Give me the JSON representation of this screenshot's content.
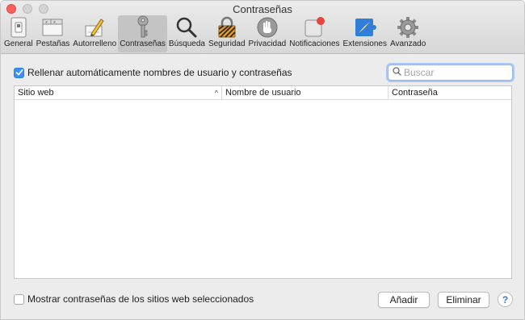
{
  "window": {
    "title": "Contraseñas"
  },
  "toolbar": {
    "items": [
      {
        "label": "General",
        "icon": "general-switch-icon"
      },
      {
        "label": "Pestañas",
        "icon": "tabs-icon"
      },
      {
        "label": "Autorrelleno",
        "icon": "pencil-icon"
      },
      {
        "label": "Contraseñas",
        "icon": "key-icon",
        "selected": true
      },
      {
        "label": "Búsqueda",
        "icon": "magnifier-icon"
      },
      {
        "label": "Seguridad",
        "icon": "lock-icon"
      },
      {
        "label": "Privacidad",
        "icon": "hand-icon"
      },
      {
        "label": "Notificaciones",
        "icon": "notification-icon"
      },
      {
        "label": "Extensiones",
        "icon": "compass-puzzle-icon"
      },
      {
        "label": "Avanzado",
        "icon": "gear-icon"
      }
    ]
  },
  "autofill": {
    "label": "Rellenar automáticamente nombres de usuario y contraseñas",
    "checked": true
  },
  "search": {
    "placeholder": "Buscar",
    "value": ""
  },
  "table": {
    "columns": [
      "Sitio web",
      "Nombre de usuario",
      "Contraseña"
    ],
    "sort_indicator": "^",
    "rows": []
  },
  "show_passwords": {
    "label": "Mostrar contraseñas de los sitios web seleccionados",
    "checked": false
  },
  "buttons": {
    "add": "Añadir",
    "remove": "Eliminar",
    "help": "?"
  },
  "colors": {
    "accent": "#3a8ff6",
    "close": "#fc605b"
  }
}
